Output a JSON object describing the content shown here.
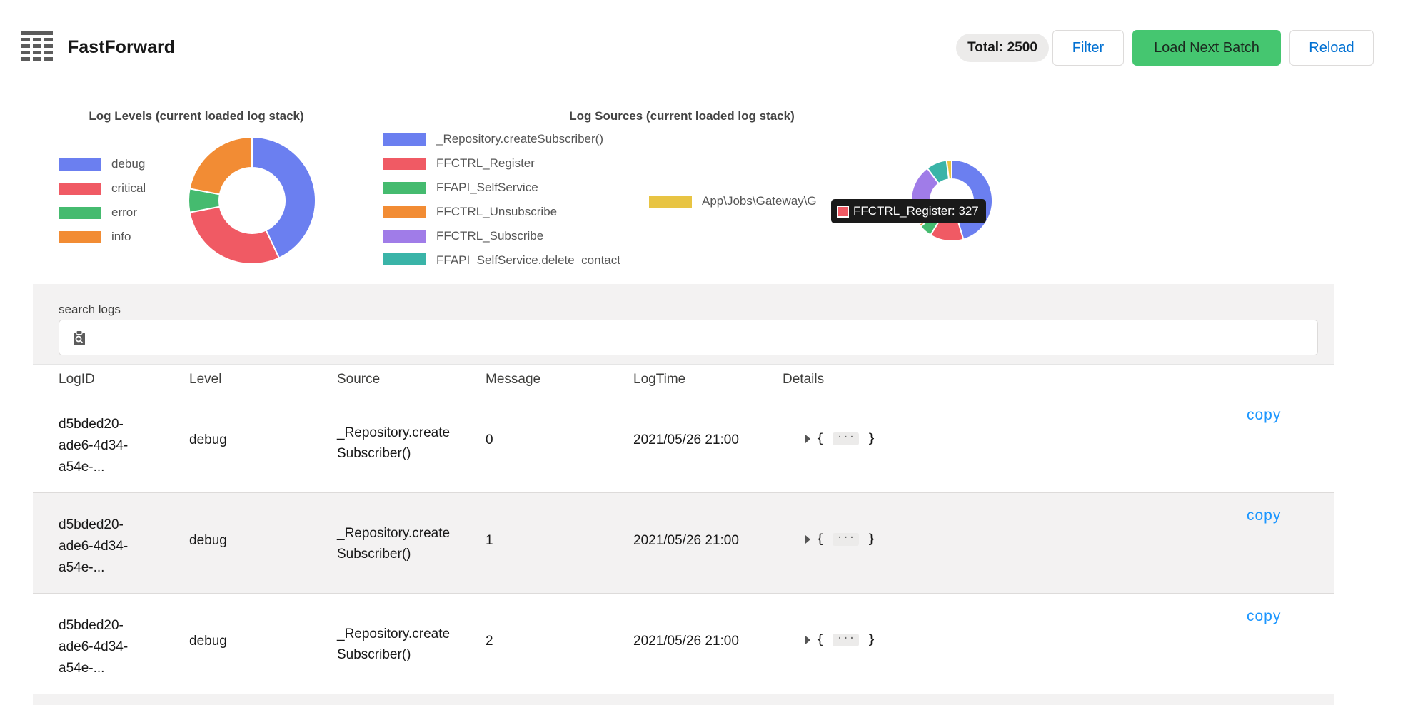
{
  "header": {
    "title": "FastForward",
    "total_label": "Total: 2500",
    "filter_label": "Filter",
    "load_next_label": "Load Next Batch",
    "reload_label": "Reload"
  },
  "levels_chart": {
    "title": "Log Levels (current loaded log stack)",
    "legend": [
      {
        "name": "debug",
        "color": "#6b7ff0"
      },
      {
        "name": "critical",
        "color": "#f05a64"
      },
      {
        "name": "error",
        "color": "#45bb6f"
      },
      {
        "name": "info",
        "color": "#f28c34"
      }
    ]
  },
  "sources_chart": {
    "title": "Log Sources (current loaded log stack)",
    "legend": [
      {
        "name": "_Repository.createSubscriber()",
        "color": "#6b7ff0"
      },
      {
        "name": "FFCTRL_Register",
        "color": "#f05a64"
      },
      {
        "name": "FFAPI_SelfService",
        "color": "#45bb6f"
      },
      {
        "name": "FFCTRL_Unsubscribe",
        "color": "#f28c34"
      },
      {
        "name": "FFCTRL_Subscribe",
        "color": "#a07ce8"
      },
      {
        "name": "FFAPI_SelfService.delete_contact",
        "color": "#3ab4a8"
      },
      {
        "name": "App\\Jobs\\Gateway\\G",
        "color": "#e8c443"
      }
    ],
    "tooltip": {
      "text": "FFCTRL_Register: 327",
      "color": "#f05a64"
    }
  },
  "chart_data": [
    {
      "type": "pie",
      "title": "Log Levels (current loaded log stack)",
      "categories": [
        "debug",
        "critical",
        "error",
        "info"
      ],
      "values": [
        43,
        29,
        6,
        22
      ]
    },
    {
      "type": "pie",
      "title": "Log Sources (current loaded log stack)",
      "categories": [
        "_Repository.createSubscriber()",
        "FFCTRL_Register",
        "FFAPI_SelfService",
        "FFCTRL_Unsubscribe",
        "FFCTRL_Subscribe",
        "FFAPI_SelfService.delete_contact",
        "App\\Jobs\\Gateway\\G"
      ],
      "values": [
        44,
        13,
        5,
        1,
        24,
        8,
        2
      ]
    }
  ],
  "search": {
    "label": "search logs",
    "value": "",
    "placeholder": ""
  },
  "table": {
    "columns": [
      "LogID",
      "Level",
      "Source",
      "Message",
      "LogTime",
      "Details"
    ],
    "copy_label": "copy",
    "details_open": "{",
    "details_close": "}",
    "details_ellipsis": "···",
    "rows": [
      {
        "id_lines": [
          "d5bded20-",
          "ade6-4d34-",
          "a54e-..."
        ],
        "level": "debug",
        "source_lines": [
          "_Repository.create",
          "Subscriber()"
        ],
        "message": "0",
        "time": "2021/05/26 21:00"
      },
      {
        "id_lines": [
          "d5bded20-",
          "ade6-4d34-",
          "a54e-..."
        ],
        "level": "debug",
        "source_lines": [
          "_Repository.create",
          "Subscriber()"
        ],
        "message": "1",
        "time": "2021/05/26 21:00"
      },
      {
        "id_lines": [
          "d5bded20-",
          "ade6-4d34-",
          "a54e-..."
        ],
        "level": "debug",
        "source_lines": [
          "_Repository.create",
          "Subscriber()"
        ],
        "message": "2",
        "time": "2021/05/26 21:00"
      }
    ]
  }
}
